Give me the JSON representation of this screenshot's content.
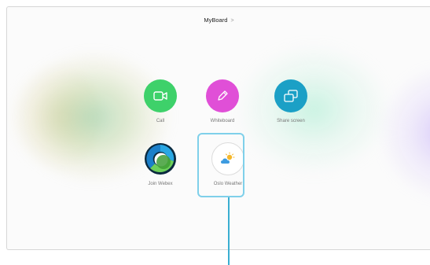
{
  "header": {
    "title": "MyBoard",
    "chevron": ">"
  },
  "tiles": [
    {
      "label": "Call",
      "icon": "video-camera-icon",
      "color": "#3ed16a"
    },
    {
      "label": "Whiteboard",
      "icon": "pencil-icon",
      "color": "#e04fd7"
    },
    {
      "label": "Share screen",
      "icon": "share-screen-icon",
      "color": "#1ba0c6"
    },
    {
      "label": "Join Webex",
      "icon": "webex-logo-icon",
      "color": "#1b8fd6"
    },
    {
      "label": "Oslo Weather",
      "icon": "partly-cloudy-icon",
      "color": "#ffffff"
    }
  ],
  "selection": {
    "highlight_color": "#7fd0ea",
    "callout_color": "#3aaed1"
  }
}
